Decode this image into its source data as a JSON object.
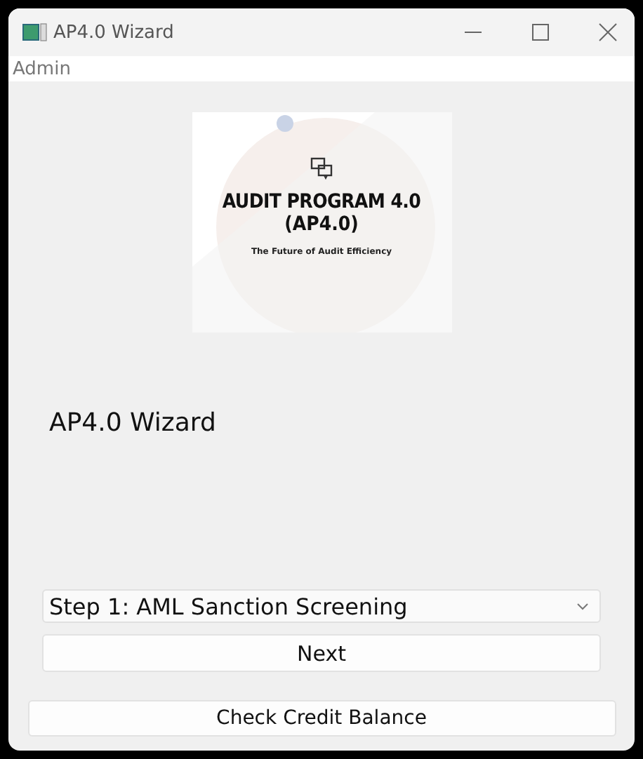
{
  "window": {
    "title": "AP4.0 Wizard"
  },
  "menu": [
    "Admin"
  ],
  "banner": {
    "title": "AUDIT PROGRAM 4.0",
    "subtitle": "(AP4.0)",
    "tagline": "The Future of Audit Efficiency"
  },
  "heading": "AP4.0 Wizard",
  "step_select": {
    "value": "Step 1: AML Sanction Screening"
  },
  "buttons": [
    {
      "label": "Next",
      "kind": "inner"
    },
    {
      "label": "Check Credit Balance",
      "kind": "outer"
    }
  ]
}
